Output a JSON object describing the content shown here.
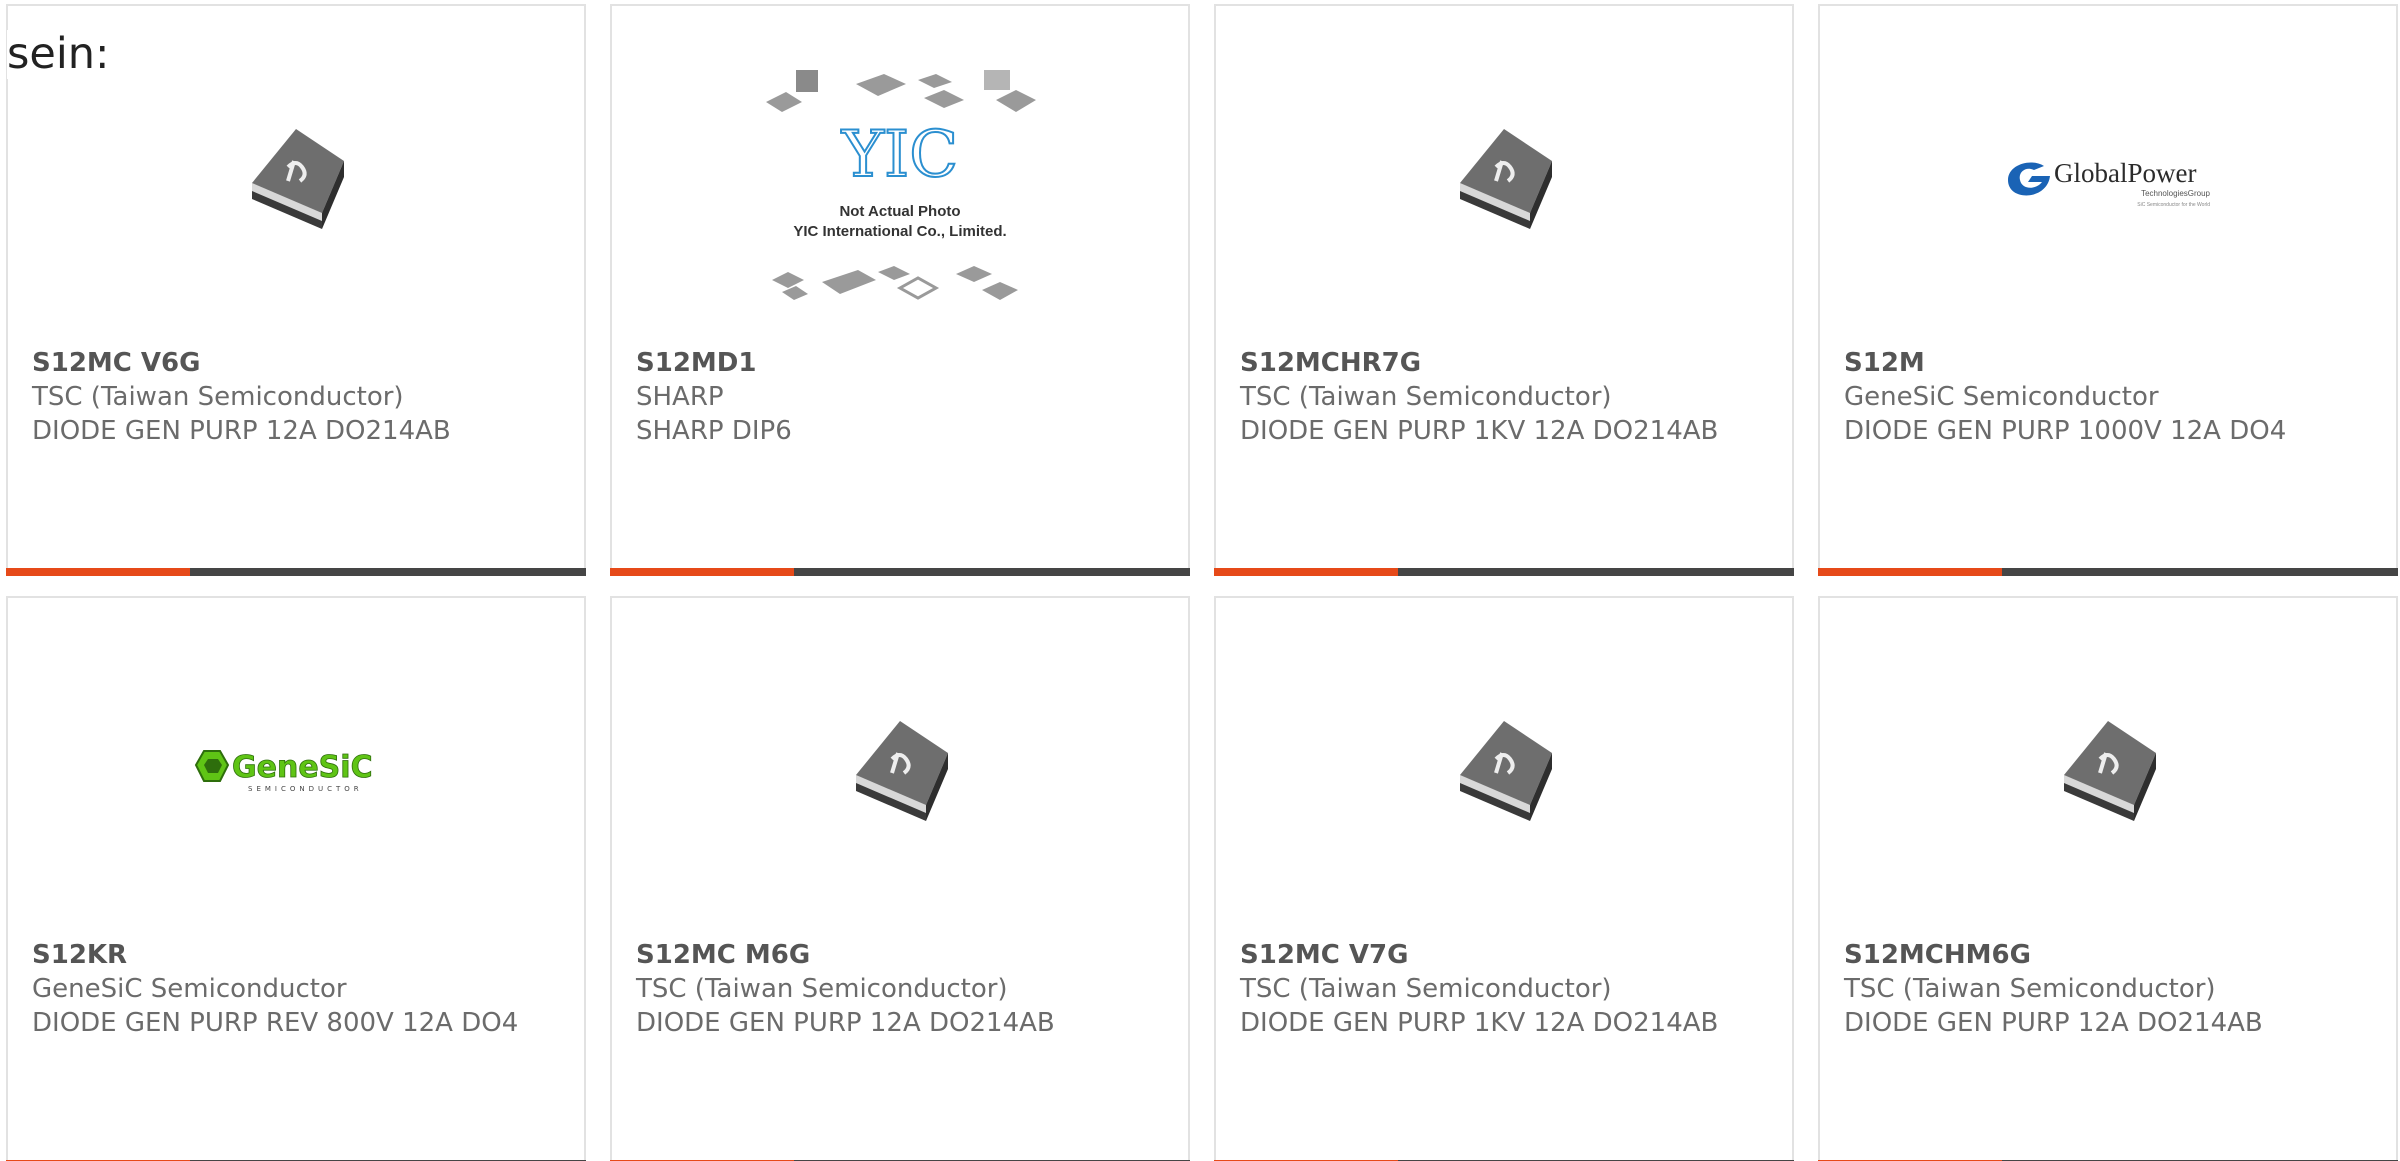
{
  "intro_text": "sein:",
  "colors": {
    "accent_bar": "#e64a19",
    "dark_bar": "#454545",
    "genesic_green": "#5fc415",
    "globalpower_blue": "#1a63b5",
    "yic_blue": "#2b8fd0"
  },
  "products": [
    {
      "part_number": "S12MC V6G",
      "manufacturer": "TSC (Taiwan Semiconductor)",
      "description": "DIODE GEN PURP 12A DO214AB",
      "image": "smd-diode-package"
    },
    {
      "part_number": "S12MD1",
      "manufacturer": "SHARP",
      "description": "SHARP DIP6",
      "image": "yic-placeholder",
      "image_text": {
        "logo": "YIC",
        "line1": "Not Actual Photo",
        "line2": "YIC International Co., Limited."
      }
    },
    {
      "part_number": "S12MCHR7G",
      "manufacturer": "TSC (Taiwan Semiconductor)",
      "description": "DIODE GEN PURP 1KV 12A DO214AB",
      "image": "smd-diode-package"
    },
    {
      "part_number": "S12M",
      "manufacturer": "GeneSiC Semiconductor",
      "description": "DIODE GEN PURP 1000V 12A DO4",
      "image": "globalpower-logo",
      "image_text": {
        "logo": "GlobalPower",
        "line1": "TechnologiesGroup",
        "line2": "SiC Semiconductor for the World"
      }
    },
    {
      "part_number": "S12KR",
      "manufacturer": "GeneSiC Semiconductor",
      "description": "DIODE GEN PURP REV 800V 12A DO4",
      "image": "genesic-logo",
      "image_text": {
        "logo": "GeneSiC",
        "line1": "SEMICONDUCTOR"
      }
    },
    {
      "part_number": "S12MC M6G",
      "manufacturer": "TSC (Taiwan Semiconductor)",
      "description": "DIODE GEN PURP 12A DO214AB",
      "image": "smd-diode-package"
    },
    {
      "part_number": "S12MC V7G",
      "manufacturer": "TSC (Taiwan Semiconductor)",
      "description": "DIODE GEN PURP 1KV 12A DO214AB",
      "image": "smd-diode-package"
    },
    {
      "part_number": "S12MCHM6G",
      "manufacturer": "TSC (Taiwan Semiconductor)",
      "description": "DIODE GEN PURP 12A DO214AB",
      "image": "smd-diode-package"
    }
  ]
}
